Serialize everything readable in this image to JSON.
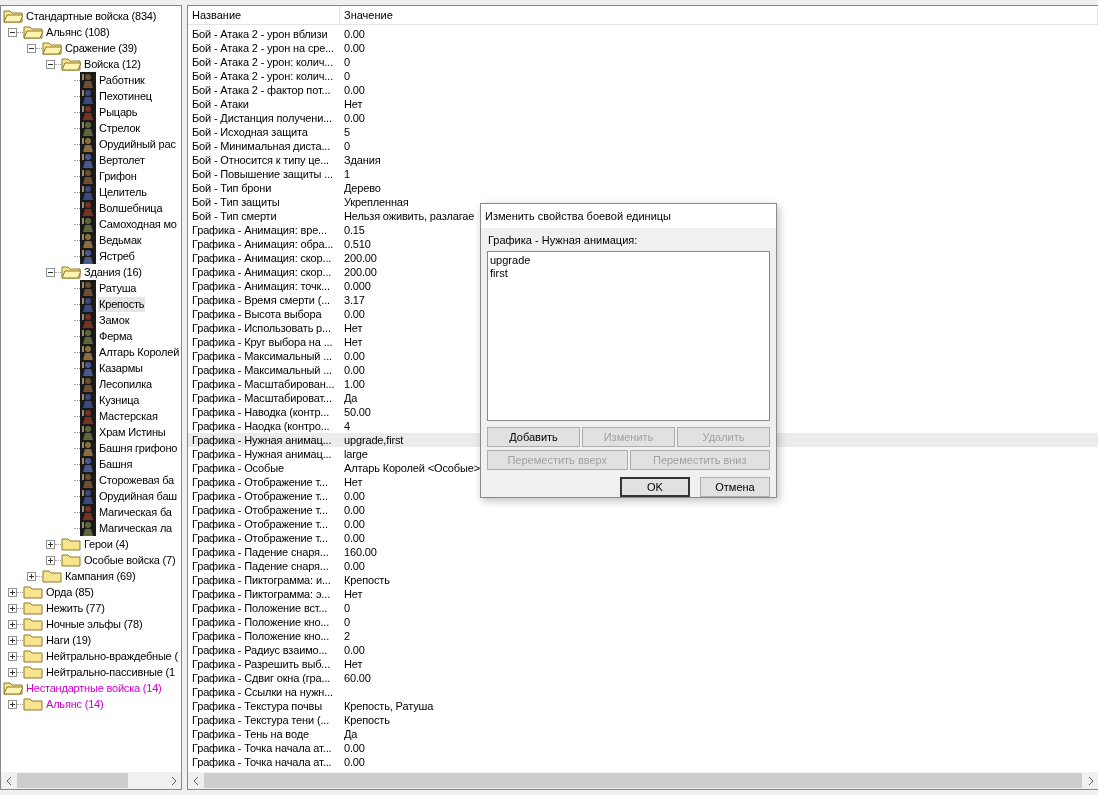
{
  "tree": [
    {
      "label": "Стандартные войска (834)",
      "kind": "folder",
      "expanded": true,
      "selected": false,
      "children": [
        {
          "label": "Альянс (108)",
          "kind": "folder",
          "expanded": true,
          "selected": false,
          "children": [
            {
              "label": "Сражение (39)",
              "kind": "folder",
              "expanded": true,
              "selected": false,
              "children": [
                {
                  "label": "Войска (12)",
                  "kind": "folder",
                  "expanded": true,
                  "selected": false,
                  "children": [
                    {
                      "label": "Работник",
                      "kind": "unit",
                      "selected": false
                    },
                    {
                      "label": "Пехотинец",
                      "kind": "unit",
                      "selected": false
                    },
                    {
                      "label": "Рыцарь",
                      "kind": "unit",
                      "selected": false
                    },
                    {
                      "label": "Стрелок",
                      "kind": "unit",
                      "selected": false
                    },
                    {
                      "label": "Орудийный рас",
                      "kind": "unit",
                      "selected": false
                    },
                    {
                      "label": "Вертолет",
                      "kind": "unit",
                      "selected": false
                    },
                    {
                      "label": "Грифон",
                      "kind": "unit",
                      "selected": false
                    },
                    {
                      "label": "Целитель",
                      "kind": "unit",
                      "selected": false
                    },
                    {
                      "label": "Волшебница",
                      "kind": "unit",
                      "selected": false
                    },
                    {
                      "label": "Самоходная мо",
                      "kind": "unit",
                      "selected": false
                    },
                    {
                      "label": "Ведьмак",
                      "kind": "unit",
                      "selected": false
                    },
                    {
                      "label": "Ястреб",
                      "kind": "unit",
                      "selected": false
                    }
                  ]
                },
                {
                  "label": "Здания (16)",
                  "kind": "folder",
                  "expanded": true,
                  "selected": false,
                  "children": [
                    {
                      "label": "Ратуша",
                      "kind": "unit",
                      "selected": false
                    },
                    {
                      "label": "Крепость",
                      "kind": "unit",
                      "selected": true
                    },
                    {
                      "label": "Замок",
                      "kind": "unit",
                      "selected": false
                    },
                    {
                      "label": "Ферма",
                      "kind": "unit",
                      "selected": false
                    },
                    {
                      "label": "Алтарь Королей",
                      "kind": "unit",
                      "selected": false
                    },
                    {
                      "label": "Казармы",
                      "kind": "unit",
                      "selected": false
                    },
                    {
                      "label": "Лесопилка",
                      "kind": "unit",
                      "selected": false
                    },
                    {
                      "label": "Кузница",
                      "kind": "unit",
                      "selected": false
                    },
                    {
                      "label": "Мастерская",
                      "kind": "unit",
                      "selected": false
                    },
                    {
                      "label": "Храм Истины",
                      "kind": "unit",
                      "selected": false
                    },
                    {
                      "label": "Башня грифоно",
                      "kind": "unit",
                      "selected": false
                    },
                    {
                      "label": "Башня",
                      "kind": "unit",
                      "selected": false
                    },
                    {
                      "label": "Сторожевая ба",
                      "kind": "unit",
                      "selected": false
                    },
                    {
                      "label": "Орудийная баш",
                      "kind": "unit",
                      "selected": false
                    },
                    {
                      "label": "Магическая ба",
                      "kind": "unit",
                      "selected": false
                    },
                    {
                      "label": "Магическая ла",
                      "kind": "unit",
                      "selected": false
                    }
                  ]
                },
                {
                  "label": "Герои (4)",
                  "kind": "folder",
                  "expanded": false,
                  "selected": false
                },
                {
                  "label": "Особые войска (7)",
                  "kind": "folder",
                  "expanded": false,
                  "selected": false
                }
              ]
            },
            {
              "label": "Кампания (69)",
              "kind": "folder",
              "expanded": false,
              "selected": false
            }
          ]
        },
        {
          "label": "Орда (85)",
          "kind": "folder",
          "expanded": false,
          "selected": false
        },
        {
          "label": "Нежить (77)",
          "kind": "folder",
          "expanded": false,
          "selected": false
        },
        {
          "label": "Ночные эльфы (78)",
          "kind": "folder",
          "expanded": false,
          "selected": false
        },
        {
          "label": "Наги (19)",
          "kind": "folder",
          "expanded": false,
          "selected": false
        },
        {
          "label": "Нейтрально-враждебные (",
          "kind": "folder",
          "expanded": false,
          "selected": false
        },
        {
          "label": "Нейтрально-пассивные (1",
          "kind": "folder",
          "expanded": false,
          "selected": false
        }
      ]
    },
    {
      "label": "Нестандартные войска (14)",
      "kind": "folder",
      "expanded": true,
      "selected": false,
      "color": "#cc00cc",
      "children": [
        {
          "label": "Альянс (14)",
          "kind": "folder",
          "expanded": false,
          "selected": false,
          "color": "#cc00cc"
        }
      ]
    }
  ],
  "table": {
    "columns": [
      "Название",
      "Значение"
    ],
    "rows": [
      {
        "name": "Бой - Атака 2 - урон вблизи",
        "value": "0.00",
        "selected": false
      },
      {
        "name": "Бой - Атака 2 - урон на сре...",
        "value": "0.00",
        "selected": false
      },
      {
        "name": "Бой - Атака 2 - урон: колич...",
        "value": "0",
        "selected": false
      },
      {
        "name": "Бой - Атака 2 - урон: колич...",
        "value": "0",
        "selected": false
      },
      {
        "name": "Бой - Атака 2 - фактор пот...",
        "value": "0.00",
        "selected": false
      },
      {
        "name": "Бой - Атаки",
        "value": "Нет",
        "selected": false
      },
      {
        "name": "Бой - Дистанция получени...",
        "value": "0.00",
        "selected": false
      },
      {
        "name": "Бой - Исходная защита",
        "value": "5",
        "selected": false
      },
      {
        "name": "Бой - Минимальная диста...",
        "value": "0",
        "selected": false
      },
      {
        "name": "Бой - Относится к типу це...",
        "value": "Здания",
        "selected": false
      },
      {
        "name": "Бой - Повышение защиты ...",
        "value": "1",
        "selected": false
      },
      {
        "name": "Бой - Тип брони",
        "value": "Дерево",
        "selected": false
      },
      {
        "name": "Бой - Тип защиты",
        "value": "Укрепленная",
        "selected": false
      },
      {
        "name": "Бой - Тип смерти",
        "value": "Нельзя оживить, разлагае",
        "selected": false
      },
      {
        "name": "Графика - Анимация: вре...",
        "value": "0.15",
        "selected": false
      },
      {
        "name": "Графика - Анимация: обра...",
        "value": "0.510",
        "selected": false
      },
      {
        "name": "Графика - Анимация: скор...",
        "value": "200.00",
        "selected": false
      },
      {
        "name": "Графика - Анимация: скор...",
        "value": "200.00",
        "selected": false
      },
      {
        "name": "Графика - Анимация: точк...",
        "value": "0.000",
        "selected": false
      },
      {
        "name": "Графика - Время смерти (...",
        "value": "3.17",
        "selected": false
      },
      {
        "name": "Графика - Высота выбора",
        "value": "0.00",
        "selected": false
      },
      {
        "name": "Графика - Использовать р...",
        "value": "Нет",
        "selected": false
      },
      {
        "name": "Графика - Круг выбора на ...",
        "value": "Нет",
        "selected": false
      },
      {
        "name": "Графика - Максимальный ...",
        "value": "0.00",
        "selected": false
      },
      {
        "name": "Графика - Максимальный ...",
        "value": "0.00",
        "selected": false
      },
      {
        "name": "Графика - Масштабирован...",
        "value": "1.00",
        "selected": false
      },
      {
        "name": "Графика - Масштабироват...",
        "value": "Да",
        "selected": false
      },
      {
        "name": "Графика - Наводка (контр...",
        "value": "50.00",
        "selected": false
      },
      {
        "name": "Графика - Наодка (контро...",
        "value": "4",
        "selected": false
      },
      {
        "name": "Графика - Нужная анимац...",
        "value": "upgrade,first",
        "selected": true
      },
      {
        "name": "Графика - Нужная анимац...",
        "value": "large",
        "selected": false
      },
      {
        "name": "Графика - Особые",
        "value": "Алтарь Королей <Особые>",
        "selected": false
      },
      {
        "name": "Графика - Отображение т...",
        "value": "Нет",
        "selected": false
      },
      {
        "name": "Графика - Отображение т...",
        "value": "0.00",
        "selected": false
      },
      {
        "name": "Графика - Отображение т...",
        "value": "0.00",
        "selected": false
      },
      {
        "name": "Графика - Отображение т...",
        "value": "0.00",
        "selected": false
      },
      {
        "name": "Графика - Отображение т...",
        "value": "0.00",
        "selected": false
      },
      {
        "name": "Графика - Падение снаря...",
        "value": "160.00",
        "selected": false
      },
      {
        "name": "Графика - Падение снаря...",
        "value": "0.00",
        "selected": false
      },
      {
        "name": "Графика - Пиктограмма: и...",
        "value": "Крепость",
        "selected": false
      },
      {
        "name": "Графика - Пиктограмма: э...",
        "value": "Нет",
        "selected": false
      },
      {
        "name": "Графика - Положение вст...",
        "value": "0",
        "selected": false
      },
      {
        "name": "Графика - Положение кно...",
        "value": "0",
        "selected": false
      },
      {
        "name": "Графика - Положение кно...",
        "value": "2",
        "selected": false
      },
      {
        "name": "Графика - Радиус взаимо...",
        "value": "0.00",
        "selected": false
      },
      {
        "name": "Графика - Разрешить выб...",
        "value": "Нет",
        "selected": false
      },
      {
        "name": "Графика - Сдвиг окна (гра...",
        "value": "60.00",
        "selected": false
      },
      {
        "name": "Графика - Ссылки на нужн...",
        "selected": false
      },
      {
        "name": "Графика - Текстура почвы",
        "value": "Крепость, Ратуша",
        "selected": false
      },
      {
        "name": "Графика - Текстура тени (...",
        "value": "Крепость",
        "selected": false
      },
      {
        "name": "Графика - Тень на воде",
        "value": "Да",
        "selected": false
      },
      {
        "name": "Графика - Точка начала ат...",
        "value": "0.00",
        "selected": false
      },
      {
        "name": "Графика - Точка начала ат...",
        "value": "0.00",
        "selected": false
      }
    ]
  },
  "dialog": {
    "title": "Изменить свойства боевой единицы",
    "label": "Графика - Нужная анимация:",
    "items": [
      "upgrade",
      "first"
    ],
    "buttons": [
      {
        "label": "Добавить",
        "disabled": false,
        "default": false
      },
      {
        "label": "Изменить",
        "disabled": true,
        "default": false
      },
      {
        "label": "Удалить",
        "disabled": true,
        "default": false
      },
      {
        "label": "Переместить вверх",
        "disabled": true,
        "default": false
      },
      {
        "label": "Переместить вниз",
        "disabled": true,
        "default": false
      },
      {
        "label": "OK",
        "disabled": false,
        "default": true
      },
      {
        "label": "Отмена",
        "disabled": false,
        "default": false
      }
    ]
  }
}
